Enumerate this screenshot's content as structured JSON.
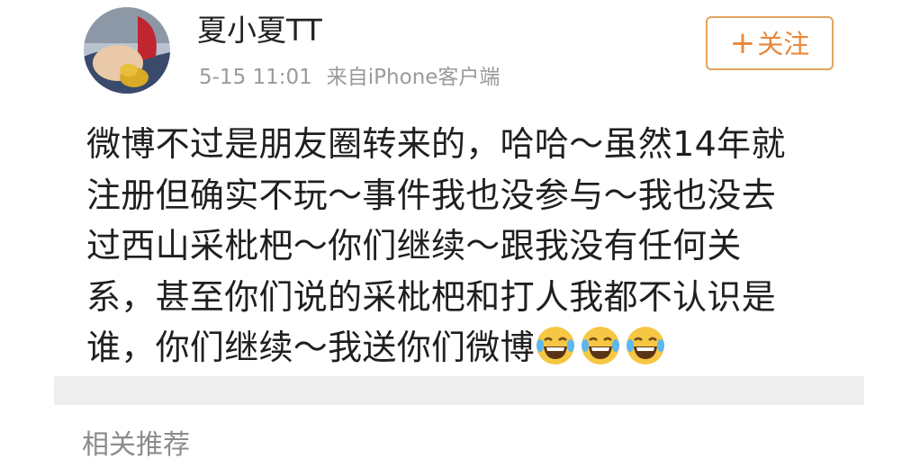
{
  "post": {
    "author": "夏小夏TT",
    "timestamp": "5-15 11:01",
    "source": "来自iPhone客户端",
    "follow_button": {
      "plus": "+",
      "label": "关注"
    },
    "content_lines": [
      "微博不过是朋友圈转来的，哈哈～虽然14年就",
      "注册但确实不玩～事件我也没参与～我也没去",
      "过西山采枇杷～你们继续～跟我没有任何关",
      "系，甚至你们说的采枇杷和打人我都不认识是",
      "谁，你们继续～我送你们微博"
    ],
    "trailing_emojis": [
      "laughing-crying-emoji",
      "laughing-crying-emoji",
      "laughing-crying-emoji"
    ]
  },
  "related": {
    "title": "相关推荐"
  },
  "colors": {
    "follow_accent": "#e8873a",
    "follow_border": "#e2a45c",
    "meta_text": "#9a9a9a",
    "divider_band": "#eeeeee"
  }
}
